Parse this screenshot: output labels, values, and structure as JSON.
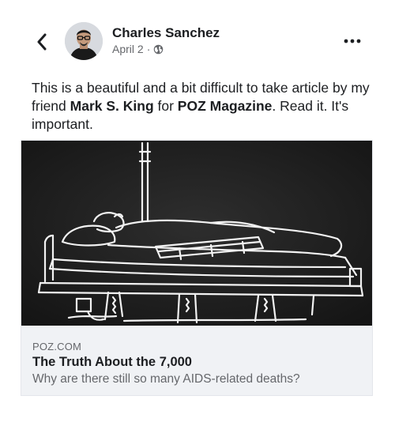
{
  "header": {
    "author_name": "Charles Sanchez",
    "date": "April 2",
    "separator": "·",
    "privacy_icon": "globe-icon",
    "back_icon": "chevron-left-icon",
    "more_icon": "more-horizontal-icon"
  },
  "post": {
    "text_before_mention": "This is a beautiful and a bit difficult to take article by my friend ",
    "mention_name": "Mark S. King",
    "text_between": " for ",
    "mention_magazine": "POZ Magazine",
    "text_after": ". Read it. It's important."
  },
  "link_card": {
    "image_icon": "hospital-bed-illustration",
    "domain": "POZ.COM",
    "title": "The Truth About the 7,000",
    "subtitle": "Why are there still so many AIDS-related deaths?"
  },
  "colors": {
    "text_primary": "#1c1e21",
    "text_secondary": "#65676b",
    "card_background": "#f0f2f5",
    "image_background": "#1f1f1f"
  }
}
